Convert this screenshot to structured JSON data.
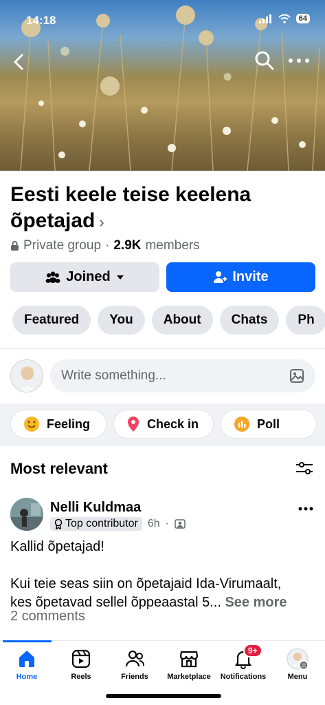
{
  "status": {
    "time": "14:18",
    "battery": "64"
  },
  "group": {
    "title": "Eesti keele teise keelena õpetajad",
    "privacy": "Private group",
    "members_count": "2.9K",
    "members_label": "members"
  },
  "buttons": {
    "joined": "Joined",
    "invite": "Invite"
  },
  "chips": [
    "Featured",
    "You",
    "About",
    "Chats",
    "Ph"
  ],
  "composer": {
    "placeholder": "Write something..."
  },
  "actions": [
    "Feeling",
    "Check in",
    "Poll"
  ],
  "feed": {
    "section_title": "Most relevant"
  },
  "post": {
    "author": "Nelli Kuldmaa",
    "badge": "Top contributor",
    "time": "6h",
    "line1": "Kallid õpetajad!",
    "line2": "Kui teie seas siin on õpetajaid Ida-Virumaalt,",
    "line3": "kes õpetavad sellel õppeaastal 5...",
    "see_more": "See more",
    "comments": "2 comments"
  },
  "tabs": [
    {
      "label": "Home",
      "icon": "home-icon"
    },
    {
      "label": "Reels",
      "icon": "reels-icon"
    },
    {
      "label": "Friends",
      "icon": "friends-icon"
    },
    {
      "label": "Marketplace",
      "icon": "marketplace-icon"
    },
    {
      "label": "Notifications",
      "icon": "bell-icon",
      "badge": "9+"
    },
    {
      "label": "Menu",
      "icon": "profile-menu-icon"
    }
  ],
  "colors": {
    "accent": "#0866ff",
    "badge_red": "#e41e3f",
    "chip_bg": "#e4e6eb"
  }
}
